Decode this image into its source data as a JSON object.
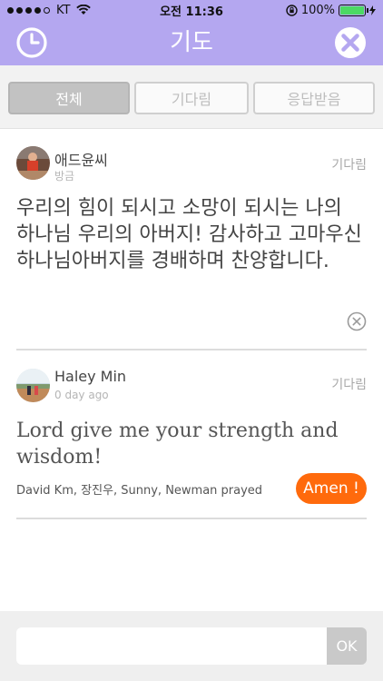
{
  "status_bar": {
    "carrier": "KT",
    "time": "오전 11:36",
    "battery": "100%"
  },
  "nav": {
    "title": "기도",
    "history_icon": "clock-icon",
    "close_icon": "close-icon",
    "accent": "#b4a7f0"
  },
  "tabs": [
    {
      "label": "전체",
      "active": true
    },
    {
      "label": "기다림",
      "active": false
    },
    {
      "label": "응답받음",
      "active": false
    }
  ],
  "posts": [
    {
      "author": "애드윤씨",
      "time": "방금",
      "status": "기다림",
      "body": "우리의 힘이 되시고 소망이 되시는 나의 하나님 우리의 아버지! 감사하고 고마우신 하나님아버지를 경배하며 찬양합니다.",
      "delete_icon": "delete-circle-icon"
    },
    {
      "author": "Haley Min",
      "time": "0 day ago",
      "status": "기다림",
      "body": "Lord give me your strength and wisdom!",
      "prayed": "David Km, 장진우, Sunny, Newman prayed",
      "amen_label": "Amen !",
      "amen_color": "#ff6a0c"
    }
  ],
  "composer": {
    "value": "",
    "placeholder": "",
    "ok_label": "OK"
  }
}
